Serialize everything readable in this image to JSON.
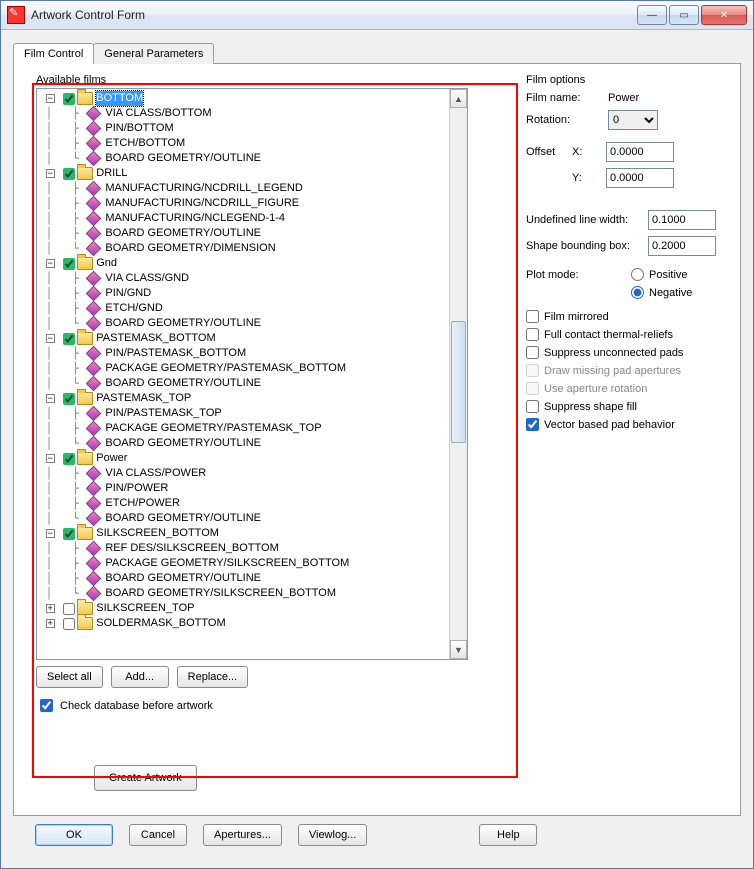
{
  "window": {
    "title": "Artwork Control Form"
  },
  "tabs": {
    "film_control": "Film Control",
    "general_parameters": "General Parameters"
  },
  "films_label": "Available films",
  "tree": {
    "bottom": {
      "name": "BOTTOM",
      "c0": "VIA CLASS/BOTTOM",
      "c1": "PIN/BOTTOM",
      "c2": "ETCH/BOTTOM",
      "c3": "BOARD GEOMETRY/OUTLINE"
    },
    "drill": {
      "name": "DRILL",
      "c0": "MANUFACTURING/NCDRILL_LEGEND",
      "c1": "MANUFACTURING/NCDRILL_FIGURE",
      "c2": "MANUFACTURING/NCLEGEND-1-4",
      "c3": "BOARD GEOMETRY/OUTLINE",
      "c4": "BOARD GEOMETRY/DIMENSION"
    },
    "gnd": {
      "name": "Gnd",
      "c0": "VIA CLASS/GND",
      "c1": "PIN/GND",
      "c2": "ETCH/GND",
      "c3": "BOARD GEOMETRY/OUTLINE"
    },
    "pmb": {
      "name": "PASTEMASK_BOTTOM",
      "c0": "PIN/PASTEMASK_BOTTOM",
      "c1": "PACKAGE GEOMETRY/PASTEMASK_BOTTOM",
      "c2": "BOARD GEOMETRY/OUTLINE"
    },
    "pmt": {
      "name": "PASTEMASK_TOP",
      "c0": "PIN/PASTEMASK_TOP",
      "c1": "PACKAGE GEOMETRY/PASTEMASK_TOP",
      "c2": "BOARD GEOMETRY/OUTLINE"
    },
    "power": {
      "name": "Power",
      "c0": "VIA CLASS/POWER",
      "c1": "PIN/POWER",
      "c2": "ETCH/POWER",
      "c3": "BOARD GEOMETRY/OUTLINE"
    },
    "silkb": {
      "name": "SILKSCREEN_BOTTOM",
      "c0": "REF DES/SILKSCREEN_BOTTOM",
      "c1": "PACKAGE GEOMETRY/SILKSCREEN_BOTTOM",
      "c2": "BOARD GEOMETRY/OUTLINE",
      "c3": "BOARD GEOMETRY/SILKSCREEN_BOTTOM"
    },
    "silkt": {
      "name": "SILKSCREEN_TOP"
    },
    "solb": {
      "name": "SOLDERMASK_BOTTOM"
    }
  },
  "buttons": {
    "select_all": "Select all",
    "add": "Add...",
    "replace": "Replace...",
    "create": "Create Artwork",
    "ok": "OK",
    "cancel": "Cancel",
    "apertures": "Apertures...",
    "viewlog": "Viewlog...",
    "help": "Help"
  },
  "check_db": "Check database before artwork",
  "film_options": {
    "title": "Film options",
    "film_name_label": "Film name:",
    "film_name_value": "Power",
    "rotation_label": "Rotation:",
    "rotation_value": "0",
    "offset_label": "Offset",
    "x_label": "X:",
    "y_label": "Y:",
    "offset_x": "0.0000",
    "offset_y": "0.0000",
    "undef_line_label": "Undefined line width:",
    "undef_line_value": "0.1000",
    "bbox_label": "Shape bounding box:",
    "bbox_value": "0.2000",
    "plot_mode_label": "Plot mode:",
    "positive": "Positive",
    "negative": "Negative",
    "film_mirrored": "Film mirrored",
    "full_contact": "Full contact thermal-reliefs",
    "suppress_pads": "Suppress unconnected pads",
    "draw_missing": "Draw missing pad apertures",
    "aperture_rot": "Use aperture rotation",
    "suppress_shape": "Suppress shape fill",
    "vector_pad": "Vector based pad behavior"
  }
}
